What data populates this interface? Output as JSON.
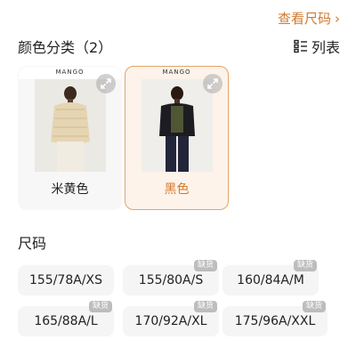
{
  "header": {
    "size_chart_label": "查看尺码",
    "list_toggle_label": "列表"
  },
  "colors": {
    "section_title": "颜色分类（2）",
    "items": [
      {
        "brand": "MANGO",
        "label": "米黄色",
        "selected": false
      },
      {
        "brand": "MANGO",
        "label": "黑色",
        "selected": true
      }
    ]
  },
  "sizes": {
    "section_title": "尺码",
    "items": [
      {
        "label": "155/78A/XS",
        "badge": ""
      },
      {
        "label": "155/80A/S",
        "badge": "缺货"
      },
      {
        "label": "160/84A/M",
        "badge": "缺货"
      },
      {
        "label": "165/88A/L",
        "badge": "缺货"
      },
      {
        "label": "170/92A/XL",
        "badge": "缺货"
      },
      {
        "label": "175/96A/XXL",
        "badge": "缺货"
      }
    ]
  },
  "theme": {
    "accent": "#d07a2e",
    "selected_bg": "#fdf3ea",
    "chip_bg": "#f5f5f5",
    "badge_bg": "#bdbdbd"
  }
}
